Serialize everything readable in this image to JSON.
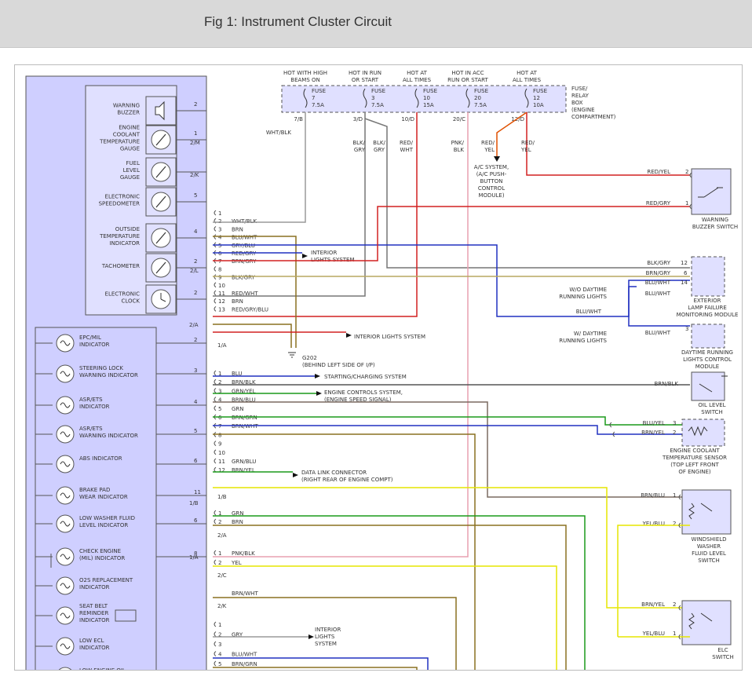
{
  "header": {
    "title": "Fig 1: Instrument Cluster Circuit"
  },
  "colors": {
    "cluster_fill": "#cfcfff",
    "module_fill": "#e0e0ff",
    "outline": "#555555",
    "wire_red": "#d22020",
    "wire_blue": "#2030c0",
    "wire_gray": "#9a9a9a",
    "wire_brown": "#8a7020",
    "wire_green": "#1a9a1a",
    "wire_yellow": "#e6e600",
    "wire_pink": "#e8a0b0",
    "wire_orange": "#e05000",
    "wire_olive": "#b8a860",
    "wire_black": "#333333"
  },
  "fuse_box": {
    "label": [
      "FUSE/",
      "RELAY",
      "BOX",
      "(ENGINE",
      "COMPARTMENT)"
    ],
    "fuses": [
      {
        "hot": [
          "HOT WITH HIGH",
          "BEAMS ON"
        ],
        "name": [
          "FUSE",
          "7",
          "7.5A"
        ],
        "terminal": "7/B",
        "wire": [
          "WHT/BLK"
        ]
      },
      {
        "hot": [
          "HOT IN RUN",
          "OR START"
        ],
        "name": [
          "FUSE",
          "3",
          "7.5A"
        ],
        "terminal": "3/D",
        "wire": [
          "BLK/",
          "GRY"
        ],
        "wire2": [
          "BLK/",
          "GRY"
        ]
      },
      {
        "hot": [
          "HOT AT",
          "ALL TIMES"
        ],
        "name": [
          "FUSE",
          "10",
          "15A"
        ],
        "terminal": "10/D",
        "wire": [
          "RED/",
          "WHT"
        ]
      },
      {
        "hot": [
          "HOT IN ACC",
          "RUN OR START"
        ],
        "name": [
          "FUSE",
          "20",
          "7.5A"
        ],
        "terminal": "20/C",
        "wire": [
          "PNK/",
          "BLK"
        ]
      },
      {
        "hot": [
          "HOT AT",
          "ALL TIMES"
        ],
        "name": [
          "FUSE",
          "12",
          "10A"
        ],
        "terminal": "12/D",
        "wire": [
          "RED/",
          "YEL"
        ],
        "wire2": [
          "RED/",
          "YEL"
        ]
      }
    ]
  },
  "ac_system": [
    "A/C SYSTEM,",
    "(A/C PUSH-",
    "BUTTON",
    "CONTROL",
    "MODULE)"
  ],
  "gauges": [
    {
      "label": [
        "WARNING",
        "BUZZER"
      ],
      "icon": "speaker-icon",
      "pin": "2"
    },
    {
      "label": [
        "ENGINE",
        "COOLANT",
        "TEMPERATURE",
        "GAUGE"
      ],
      "icon": "gauge-icon",
      "pin": "1",
      "conn": "2/M"
    },
    {
      "label": [
        "FUEL",
        "LEVEL",
        "GAUGE"
      ],
      "icon": "gauge-icon",
      "pin": "",
      "conn": "2/K"
    },
    {
      "label": [
        "ELECTRONIC",
        "SPEEDOMETER"
      ],
      "icon": "gauge-icon",
      "pin": "5"
    },
    {
      "label": [
        "OUTSIDE",
        "TEMPERATURE",
        "INDICATOR"
      ],
      "icon": "gauge-icon",
      "pin": "4"
    },
    {
      "label": [
        "TACHOMETER"
      ],
      "icon": "gauge-icon",
      "pin": "2",
      "conn": "2/L"
    },
    {
      "label": [
        "ELECTRONIC",
        "CLOCK"
      ],
      "icon": "clock-icon",
      "pin": "2"
    }
  ],
  "indicators": [
    {
      "label": [
        "EPC/MIL",
        "INDICATOR"
      ],
      "pin": "2"
    },
    {
      "label": [
        "STEERING LOCK",
        "WARNING INDICATOR"
      ],
      "pin": "3"
    },
    {
      "label": [
        "ASR/ETS",
        "INDICATOR"
      ],
      "pin": "4"
    },
    {
      "label": [
        "ASR/ETS",
        "WARNING INDICATOR"
      ],
      "pin": "5"
    },
    {
      "label": [
        "ABS INDICATOR"
      ],
      "pin": "6"
    },
    {
      "label": [
        "BRAKE PAD",
        "WEAR INDICATOR"
      ],
      "pin": "11"
    },
    {
      "label": [
        "LOW WASHER FLUID",
        "LEVEL INDICATOR"
      ],
      "pin": "6"
    },
    {
      "label": [
        "CHECK ENGINE",
        "(MIL) INDICATOR"
      ],
      "pin": "8"
    },
    {
      "label": [
        "O2S REPLACEMENT",
        "INDICATOR"
      ],
      "pin": ""
    },
    {
      "label": [
        "SEAT BELT",
        "REMINDER",
        "INDICATOR"
      ],
      "pin": ""
    },
    {
      "label": [
        "LOW ECL",
        "INDICATOR"
      ],
      "pin": ""
    },
    {
      "label": [
        "LOW ENGINE OIL"
      ],
      "pin": ""
    }
  ],
  "connector_labels": {
    "c2a": "2/A",
    "c1a": "1/A",
    "c1b": "1/B",
    "c1b2": "1/B",
    "c2a2": "2/A",
    "c2c": "2/C",
    "c2k": "2/K",
    "c1a2": "1/A"
  },
  "connector_a": [
    {
      "pin": "1",
      "wire": ""
    },
    {
      "pin": "2",
      "wire": "WHT/BLK"
    },
    {
      "pin": "3",
      "wire": "BRN"
    },
    {
      "pin": "4",
      "wire": "BLU/WHT"
    },
    {
      "pin": "5",
      "wire": "GRY/BLU"
    },
    {
      "pin": "6",
      "wire": "RED/GRY"
    },
    {
      "pin": "7",
      "wire": "BRN/GRY"
    },
    {
      "pin": "8",
      "wire": ""
    },
    {
      "pin": "9",
      "wire": "BLK/GRY"
    },
    {
      "pin": "10",
      "wire": ""
    },
    {
      "pin": "11",
      "wire": "RED/WHT"
    },
    {
      "pin": "12",
      "wire": "BRN"
    },
    {
      "pin": "13",
      "wire": "RED/GRY/BLU"
    }
  ],
  "connector_b": [
    {
      "pin": "1",
      "wire": "BLU"
    },
    {
      "pin": "2",
      "wire": "BRN/BLK"
    },
    {
      "pin": "3",
      "wire": "GRN/YEL"
    },
    {
      "pin": "4",
      "wire": "BRN/BLU"
    },
    {
      "pin": "5",
      "wire": "GRN"
    },
    {
      "pin": "6",
      "wire": "BRN/GRN"
    },
    {
      "pin": "7",
      "wire": "BRN/WHT"
    },
    {
      "pin": "8",
      "wire": ""
    },
    {
      "pin": "9",
      "wire": ""
    },
    {
      "pin": "10",
      "wire": ""
    },
    {
      "pin": "11",
      "wire": "GRN/BLU"
    },
    {
      "pin": "12",
      "wire": "BRN/YEL"
    }
  ],
  "connector_c": [
    {
      "pin": "1",
      "wire": "GRN"
    },
    {
      "pin": "2",
      "wire": "BRN"
    }
  ],
  "connector_d": [
    {
      "pin": "1",
      "wire": "PNK/BLK"
    },
    {
      "pin": "2",
      "wire": "YEL"
    }
  ],
  "connector_e": [
    {
      "pin": "",
      "wire": "BRN/WHT"
    }
  ],
  "connector_f": [
    {
      "pin": "1",
      "wire": ""
    },
    {
      "pin": "2",
      "wire": "GRY"
    },
    {
      "pin": "3",
      "wire": ""
    },
    {
      "pin": "4",
      "wire": "BLU/WHT"
    },
    {
      "pin": "5",
      "wire": "BRN/GRN"
    }
  ],
  "destinations": {
    "interior1": [
      "INTERIOR",
      "LIGHTS SYSTEM"
    ],
    "interior2": "INTERIOR LIGHTS SYSTEM",
    "ground": [
      "G202",
      "(BEHIND LEFT SIDE OF I/P)"
    ],
    "starting": "STARTING/CHARGING SYSTEM",
    "engine_ctrl": [
      "ENGINE CONTROLS SYSTEM,",
      "(ENGINE SPEED SIGNAL)"
    ],
    "dlc": [
      "DATA LINK CONNECTOR",
      "(RIGHT REAR OF ENGINE COMPT)"
    ],
    "interior3": [
      "INTERIOR",
      "LIGHTS",
      "SYSTEM"
    ]
  },
  "right_components": {
    "buzzer_switch": {
      "label": [
        "WARNING",
        "BUZZER SWITCH"
      ],
      "wires": [
        {
          "wire": "RED/YEL",
          "pin": "2"
        },
        {
          "wire": "RED/GRY",
          "pin": "1"
        }
      ]
    },
    "lamp_module": {
      "label": [
        "EXTERIOR",
        "LAMP FAILURE",
        "MONITORING MODULE"
      ],
      "wires": [
        {
          "wire": "BLK/GRY",
          "pin": "12"
        },
        {
          "wire": "BRN/GRY",
          "pin": "6"
        },
        {
          "wire": "BLU/WHT",
          "pin": "14"
        },
        {
          "wire": "BLU/WHT",
          "pin": ""
        }
      ]
    },
    "wo_daytime": [
      "W/O DAYTIME",
      "RUNNING LIGHTS"
    ],
    "w_daytime": [
      "W/ DAYTIME",
      "RUNNING LIGHTS"
    ],
    "blu_wht_mid": "BLU/WHT",
    "drl_module": {
      "label": [
        "DAYTIME RUNNING",
        "LIGHTS CONTROL",
        "MODULE"
      ],
      "wires": [
        {
          "wire": "BLU/WHT",
          "pin": "3"
        }
      ]
    },
    "oil_switch": {
      "label": [
        "OIL LEVEL",
        "SWITCH"
      ],
      "wires": [
        {
          "wire": "BRN/BLK",
          "pin": ""
        }
      ]
    },
    "coolant_sensor": {
      "label": [
        "ENGINE COOLANT",
        "TEMPERATURE SENSOR",
        "(TOP LEFT FRONT",
        "OF ENGINE)"
      ],
      "wires": [
        {
          "wire": "BLU/YEL",
          "pin": "3"
        },
        {
          "wire": "BRN/YEL",
          "pin": "2"
        }
      ]
    },
    "washer_switch": {
      "label": [
        "WINDSHIELD",
        "WASHER",
        "FLUID LEVEL",
        "SWITCH"
      ],
      "wires": [
        {
          "wire": "BRN/BLU",
          "pin": "1"
        },
        {
          "wire": "YEL/BLU",
          "pin": "2"
        }
      ]
    },
    "elc_switch": {
      "label": [
        "ELC",
        "SWITCH"
      ],
      "wires": [
        {
          "wire": "BRN/YEL",
          "pin": "2"
        },
        {
          "wire": "YEL/BLU",
          "pin": "1"
        }
      ]
    }
  }
}
